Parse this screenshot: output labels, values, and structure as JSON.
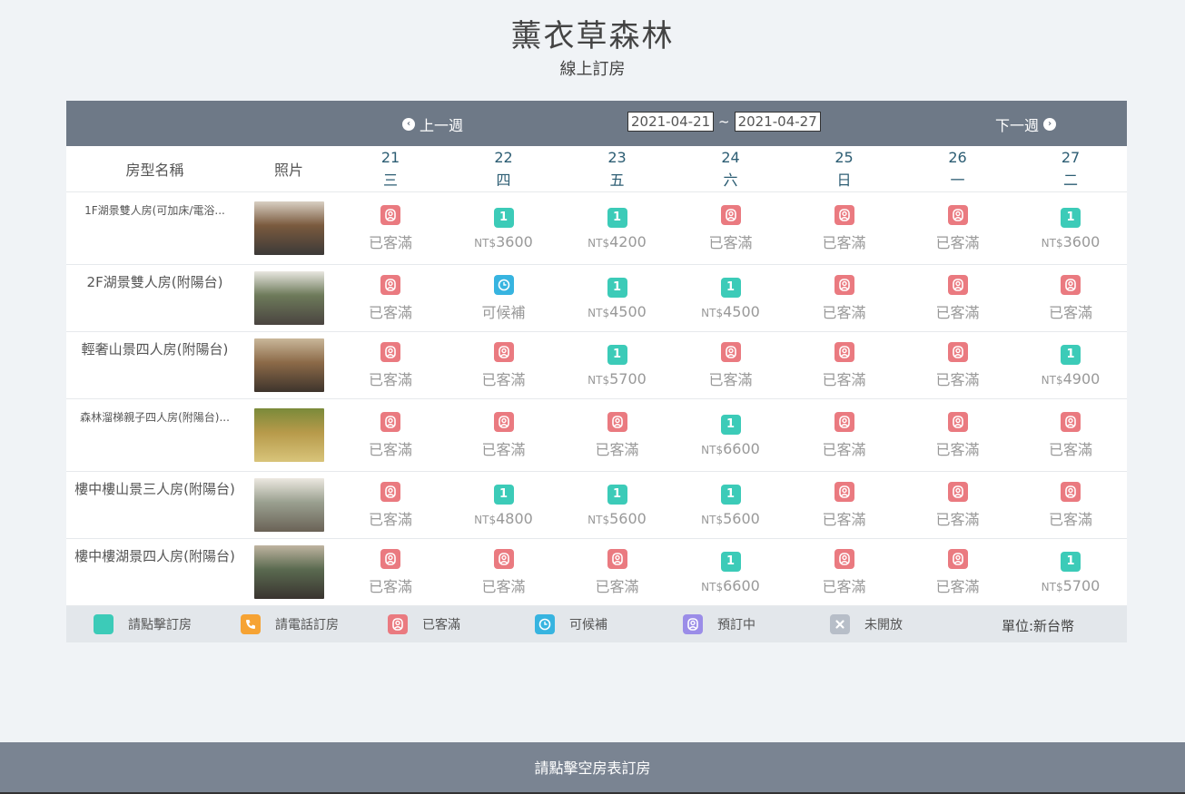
{
  "site": {
    "title": "薰衣草森林",
    "subtitle": "線上訂房"
  },
  "nav": {
    "prev": "上一週",
    "next": "下一週",
    "start_date": "2021-04-21",
    "end_date": "2021-04-27",
    "separator": "~"
  },
  "columns": {
    "room_type": "房型名稱",
    "photo": "照片"
  },
  "days": [
    {
      "num": "21",
      "wk": "三"
    },
    {
      "num": "22",
      "wk": "四"
    },
    {
      "num": "23",
      "wk": "五"
    },
    {
      "num": "24",
      "wk": "六"
    },
    {
      "num": "25",
      "wk": "日"
    },
    {
      "num": "26",
      "wk": "一"
    },
    {
      "num": "27",
      "wk": "二"
    }
  ],
  "currency": "NT$",
  "icons": {
    "available": "1",
    "full": "person-icon",
    "waitlist": "clock-icon"
  },
  "rooms": [
    {
      "name": "1F湖景雙人房(可加床/電浴...",
      "small": true,
      "photo_colors": [
        "#7a5a3e",
        "#d8cfc3",
        "#3c3a38"
      ],
      "cells": [
        [
          "full",
          "已客滿"
        ],
        [
          "avail",
          "3600"
        ],
        [
          "avail",
          "4200"
        ],
        [
          "full",
          "已客滿"
        ],
        [
          "full",
          "已客滿"
        ],
        [
          "full",
          "已客滿"
        ],
        [
          "avail",
          "3600"
        ]
      ]
    },
    {
      "name": "2F湖景雙人房(附陽台)",
      "small": false,
      "photo_colors": [
        "#6d7a5a",
        "#e8e6e0",
        "#4a4440"
      ],
      "cells": [
        [
          "full",
          "已客滿"
        ],
        [
          "wait",
          "可候補"
        ],
        [
          "avail",
          "4500"
        ],
        [
          "avail",
          "4500"
        ],
        [
          "full",
          "已客滿"
        ],
        [
          "full",
          "已客滿"
        ],
        [
          "full",
          "已客滿"
        ]
      ]
    },
    {
      "name": "輕奢山景四人房(附陽台)",
      "small": false,
      "photo_colors": [
        "#8c6a48",
        "#c9b79a",
        "#3e342c"
      ],
      "cells": [
        [
          "full",
          "已客滿"
        ],
        [
          "full",
          "已客滿"
        ],
        [
          "avail",
          "5700"
        ],
        [
          "full",
          "已客滿"
        ],
        [
          "full",
          "已客滿"
        ],
        [
          "full",
          "已客滿"
        ],
        [
          "avail",
          "4900"
        ]
      ]
    },
    {
      "name": "森林溜梯親子四人房(附陽台)...",
      "small": true,
      "photo_colors": [
        "#b79a4a",
        "#7a8a3a",
        "#d8c47a"
      ],
      "cells": [
        [
          "full",
          "已客滿"
        ],
        [
          "full",
          "已客滿"
        ],
        [
          "full",
          "已客滿"
        ],
        [
          "avail",
          "6600"
        ],
        [
          "full",
          "已客滿"
        ],
        [
          "full",
          "已客滿"
        ],
        [
          "full",
          "已客滿"
        ]
      ]
    },
    {
      "name": "樓中樓山景三人房(附陽台)",
      "small": false,
      "photo_colors": [
        "#9aa090",
        "#ece8e0",
        "#6a6256"
      ],
      "cells": [
        [
          "full",
          "已客滿"
        ],
        [
          "avail",
          "4800"
        ],
        [
          "avail",
          "5600"
        ],
        [
          "avail",
          "5600"
        ],
        [
          "full",
          "已客滿"
        ],
        [
          "full",
          "已客滿"
        ],
        [
          "full",
          "已客滿"
        ]
      ]
    },
    {
      "name": "樓中樓湖景四人房(附陽台)",
      "small": false,
      "photo_colors": [
        "#5a6a50",
        "#bfb4a0",
        "#3a3430"
      ],
      "cells": [
        [
          "full",
          "已客滿"
        ],
        [
          "full",
          "已客滿"
        ],
        [
          "full",
          "已客滿"
        ],
        [
          "avail",
          "6600"
        ],
        [
          "full",
          "已客滿"
        ],
        [
          "full",
          "已客滿"
        ],
        [
          "avail",
          "5700"
        ]
      ]
    }
  ],
  "legend": [
    {
      "type": "avail",
      "label": "請點擊訂房"
    },
    {
      "type": "phone",
      "label": "請電話訂房"
    },
    {
      "type": "full",
      "label": "已客滿"
    },
    {
      "type": "wait",
      "label": "可候補"
    },
    {
      "type": "book",
      "label": "預訂中"
    },
    {
      "type": "closed",
      "label": "未開放"
    }
  ],
  "unit_label": "單位:新台幣",
  "footer": "請點擊空房表訂房",
  "colors": {
    "available": "#3ccbb8",
    "full": "#ea7a80",
    "waitlist": "#37b4e0",
    "phone": "#f6a334",
    "booking": "#9b8de8",
    "closed": "#b7bec8",
    "header": "#6e7987"
  }
}
